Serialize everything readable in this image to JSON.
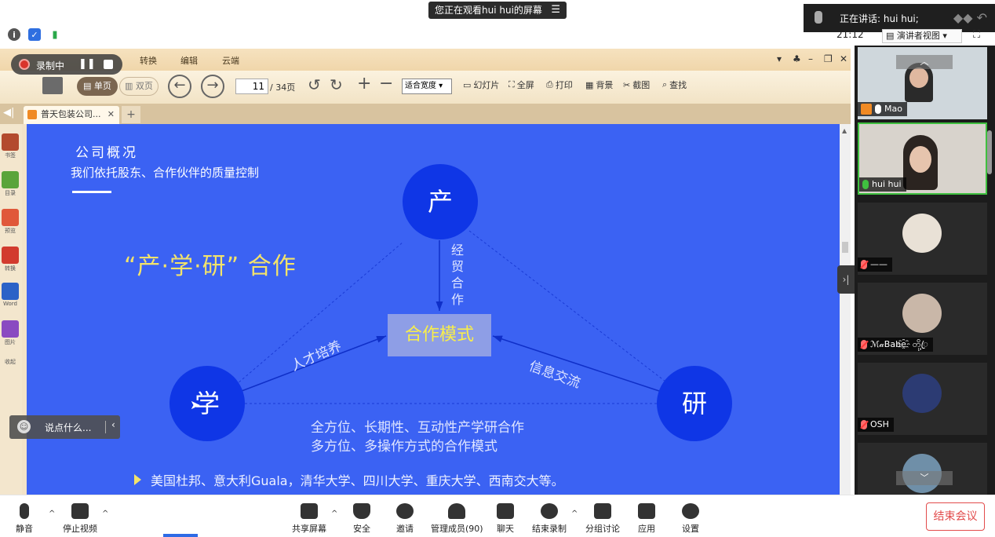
{
  "top": {
    "viewing_banner": "您正在观看hui hui的屏幕",
    "speaking": "正在讲话: hui hui;",
    "clock": "21:12",
    "view_mode": "演讲者视图"
  },
  "recording": {
    "label": "录制中"
  },
  "viewer": {
    "menu_tabs": [
      "转换",
      "编辑",
      "云端"
    ],
    "single_page": "单页",
    "double_page": "双页",
    "page_current": "11",
    "page_total": "/ 34页",
    "zoom": "适合宽度",
    "tools": [
      "幻灯片",
      "全屏",
      "打印",
      "背景",
      "截图",
      "查找"
    ],
    "doc_tab": "普天包装公司...",
    "rail": [
      "书签",
      "目录",
      "预览",
      "转换",
      "Word",
      "图片",
      "收起"
    ]
  },
  "slide": {
    "section": "公司概况",
    "subtitle": "我们依托股东、合作伙伴的质量控制",
    "heading": "“产·学·研” 合作",
    "node_top": "产",
    "node_left": "学",
    "node_right": "研",
    "center": "合作模式",
    "label_trade": "经贸合作",
    "label_talent": "人才培养",
    "label_info": "信息交流",
    "line1": "全方位、长期性、互动性产学研合作",
    "line2": "多方位、多操作方式的合作模式",
    "partners": "美国杜邦、意大利Guala，清华大学、四川大学、重庆大学、西南交大等。"
  },
  "chat_popup": {
    "placeholder": "说点什么..."
  },
  "participants": [
    {
      "name": "Mao",
      "muted": false
    },
    {
      "name": "hui hui",
      "muted": false
    },
    {
      "name": "——",
      "muted": true
    },
    {
      "name": "ℳ𝒶Babe҈ တို့ꦿ",
      "muted": true
    },
    {
      "name": "OSH",
      "muted": true
    },
    {
      "name": "",
      "muted": true
    }
  ],
  "bottom": {
    "mute": "静音",
    "stop_video": "停止视频",
    "share": "共享屏幕",
    "security": "安全",
    "invite": "邀请",
    "manage": "管理成员(90)",
    "chat": "聊天",
    "end_record": "结束录制",
    "breakout": "分组讨论",
    "apps": "应用",
    "settings": "设置",
    "end_meeting": "结束会议"
  },
  "colors": {
    "slide_bg": "#3b62f3",
    "node": "#0f36e6",
    "heading": "#f3e36a",
    "end_button": "#e24b4b"
  }
}
